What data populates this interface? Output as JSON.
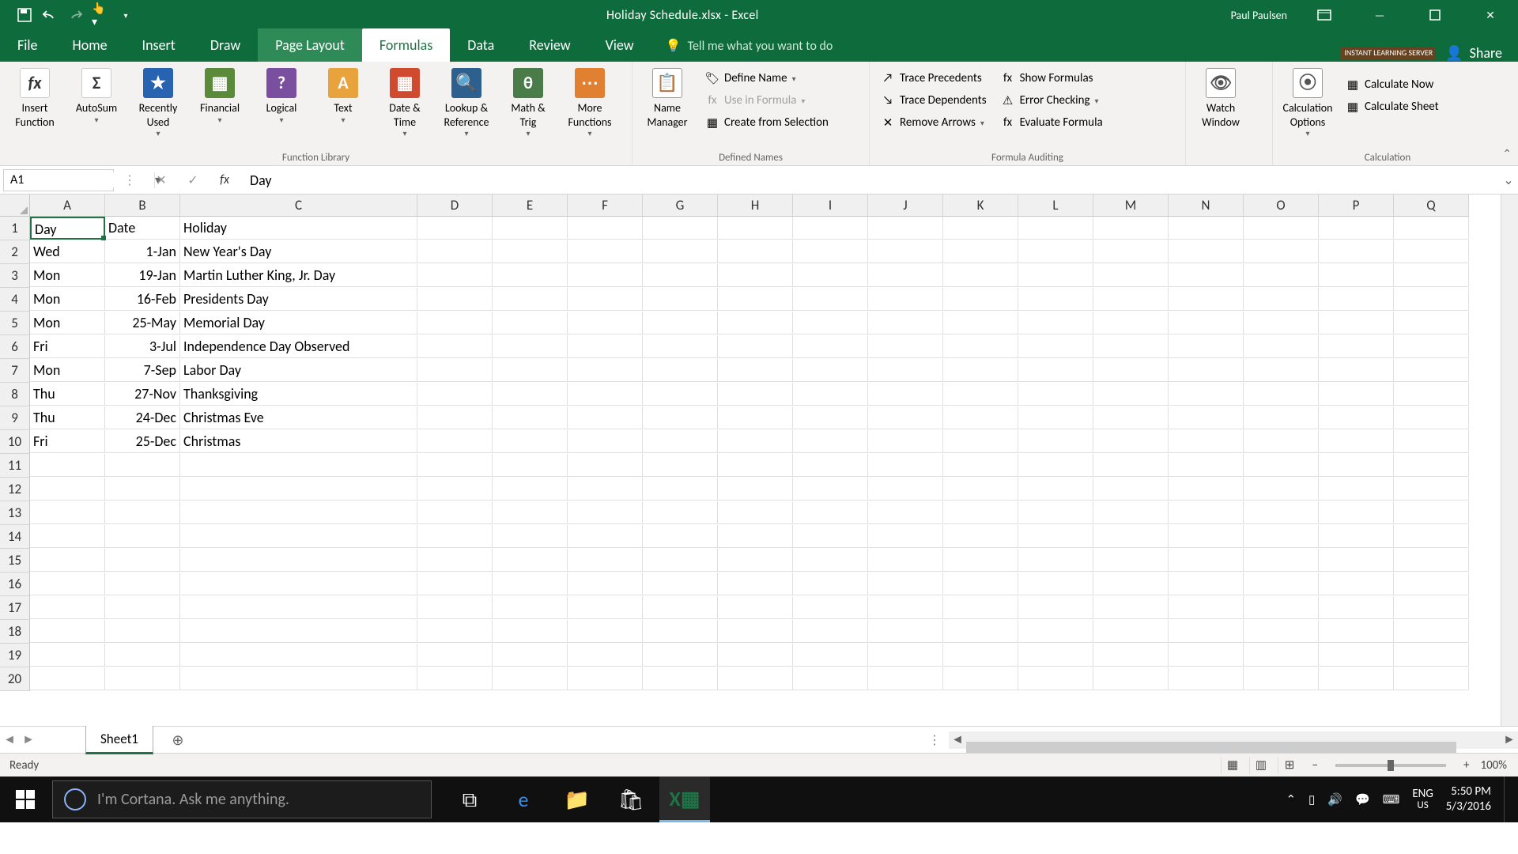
{
  "app": {
    "title": "Holiday Schedule.xlsx - Excel",
    "user": "Paul Paulsen"
  },
  "tabs": {
    "file": "File",
    "home": "Home",
    "insert": "Insert",
    "draw": "Draw",
    "pagelayout": "Page Layout",
    "formulas": "Formulas",
    "data": "Data",
    "review": "Review",
    "view": "View",
    "tellme": "Tell me what you want to do",
    "share": "Share",
    "badge": "INSTANT LEARNING SERVER"
  },
  "ribbon": {
    "insert_function": "Insert\nFunction",
    "autosum": "AutoSum",
    "recently": "Recently\nUsed",
    "financial": "Financial",
    "logical": "Logical",
    "text": "Text",
    "datetime": "Date &\nTime",
    "lookup": "Lookup &\nReference",
    "math": "Math &\nTrig",
    "more": "More\nFunctions",
    "namemanager": "Name\nManager",
    "define": "Define Name",
    "useinformula": "Use in Formula",
    "createfrom": "Create from Selection",
    "traceprec": "Trace Precedents",
    "tracedep": "Trace Dependents",
    "removearrows": "Remove Arrows",
    "showformulas": "Show Formulas",
    "errorcheck": "Error Checking",
    "evaluate": "Evaluate Formula",
    "watch": "Watch\nWindow",
    "calcoptions": "Calculation\nOptions",
    "calcnow": "Calculate Now",
    "calcsheet": "Calculate Sheet",
    "g_funclibrary": "Function Library",
    "g_definednames": "Defined Names",
    "g_auditing": "Formula Auditing",
    "g_calc": "Calculation"
  },
  "formula_bar": {
    "namebox": "A1",
    "formula": "Day"
  },
  "columns": [
    "A",
    "B",
    "C",
    "D",
    "E",
    "F",
    "G",
    "H",
    "I",
    "J",
    "K",
    "L",
    "M",
    "N",
    "O",
    "P",
    "Q"
  ],
  "headers": {
    "day": "Day",
    "date": "Date",
    "holiday": "Holiday"
  },
  "rows": [
    {
      "day": "Wed",
      "date": "1-Jan",
      "holiday": "New Year's Day"
    },
    {
      "day": "Mon",
      "date": "19-Jan",
      "holiday": "Martin Luther King, Jr. Day"
    },
    {
      "day": "Mon",
      "date": "16-Feb",
      "holiday": "Presidents Day"
    },
    {
      "day": "Mon",
      "date": "25-May",
      "holiday": "Memorial Day"
    },
    {
      "day": "Fri",
      "date": "3-Jul",
      "holiday": "Independence Day Observed"
    },
    {
      "day": "Mon",
      "date": "7-Sep",
      "holiday": "Labor Day"
    },
    {
      "day": "Thu",
      "date": "27-Nov",
      "holiday": "Thanksgiving"
    },
    {
      "day": "Thu",
      "date": "24-Dec",
      "holiday": "Christmas Eve"
    },
    {
      "day": "Fri",
      "date": "25-Dec",
      "holiday": "Christmas"
    }
  ],
  "sheet": {
    "name": "Sheet1"
  },
  "status": {
    "ready": "Ready",
    "zoom": "100%",
    "lang": "ENG",
    "lang2": "US"
  },
  "taskbar": {
    "cortana": "I'm Cortana. Ask me anything.",
    "time": "5:50 PM",
    "date": "5/3/2016"
  }
}
